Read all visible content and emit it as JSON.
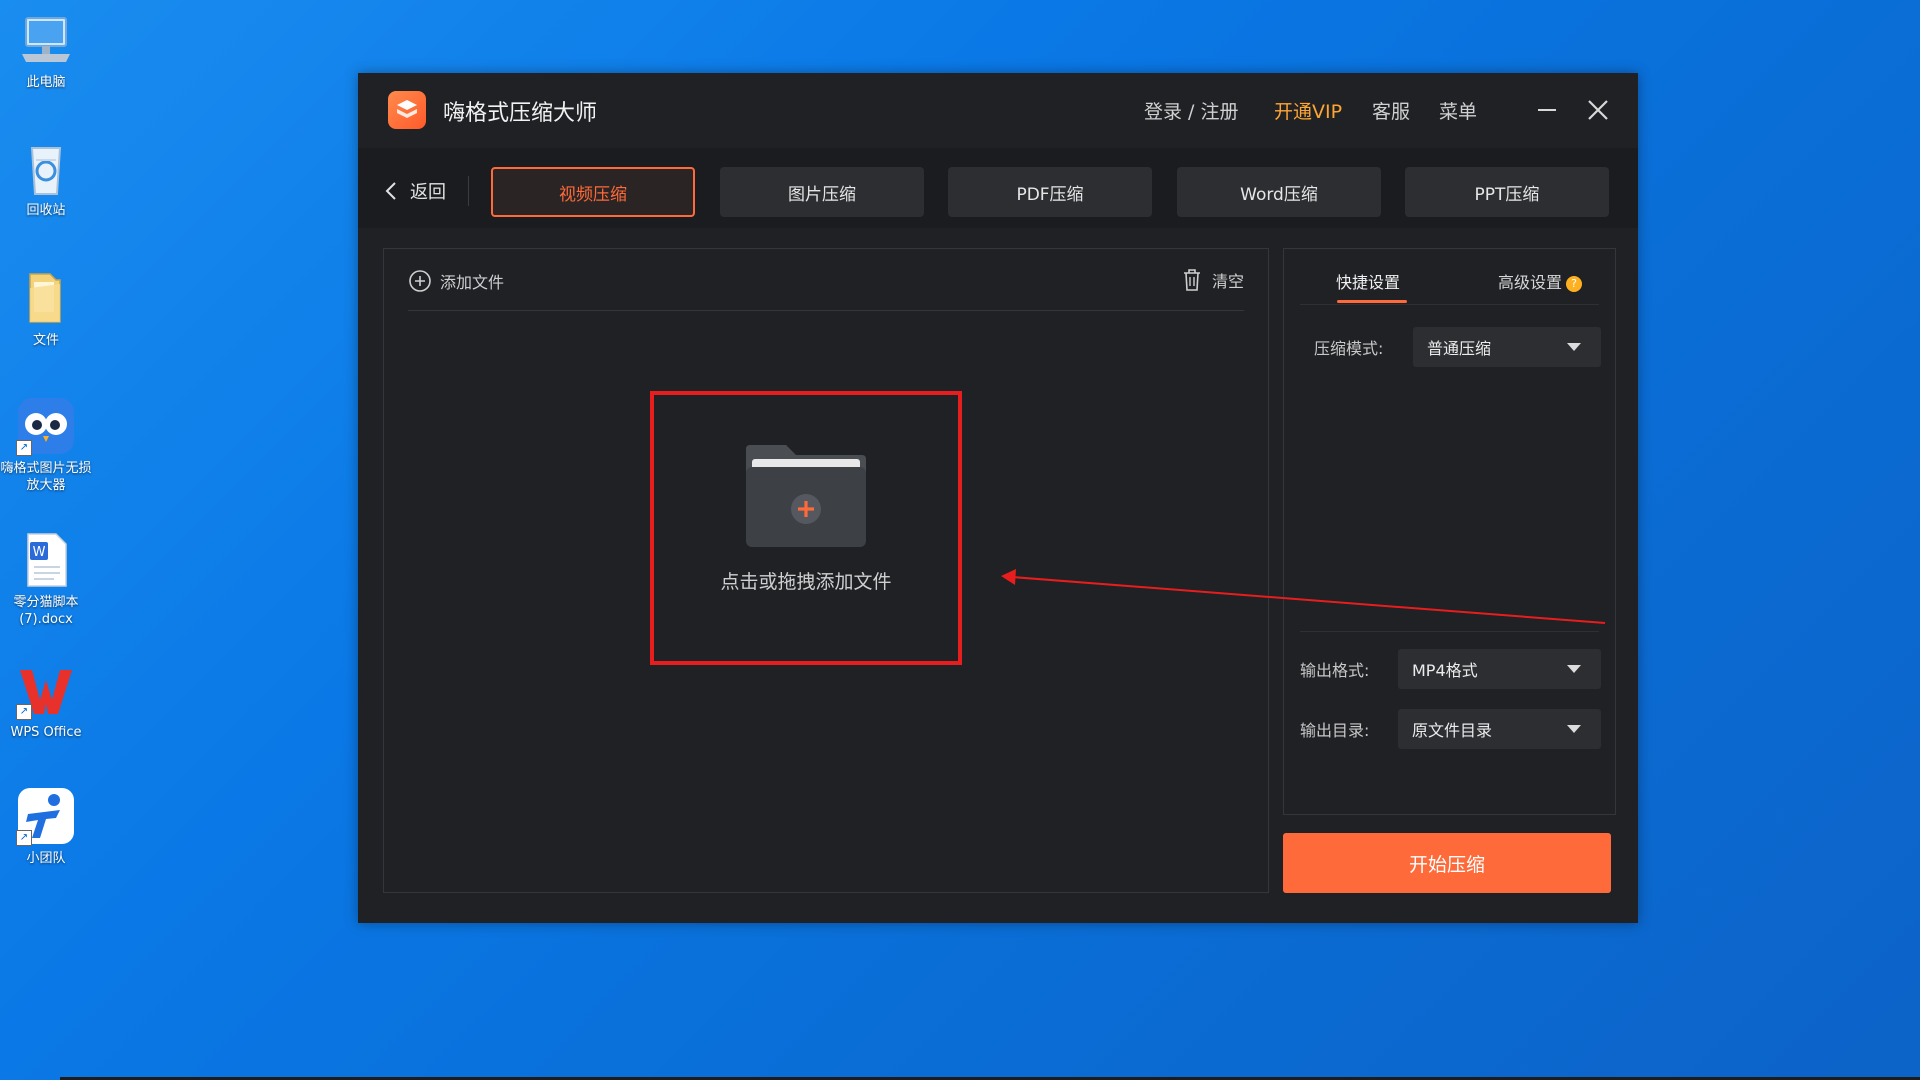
{
  "desktop": {
    "icons": [
      {
        "label": "此电脑",
        "icon": "computer-icon"
      },
      {
        "label": "回收站",
        "icon": "recycle-bin-icon"
      },
      {
        "label": "文件",
        "icon": "folder-icon"
      },
      {
        "label": "嗨格式图片无损放大器",
        "icon": "owl-app-icon"
      },
      {
        "label": "零分猫脚本(7).docx",
        "icon": "word-doc-icon"
      },
      {
        "label": "WPS Office",
        "icon": "wps-icon"
      },
      {
        "label": "小团队",
        "icon": "team-app-icon"
      }
    ]
  },
  "app": {
    "title": "嗨格式压缩大师",
    "header_links": {
      "login": "登录 / 注册",
      "vip": "开通VIP",
      "service": "客服",
      "menu": "菜单"
    },
    "back_label": "返回",
    "tabs": [
      {
        "label": "视频压缩",
        "active": true
      },
      {
        "label": "图片压缩",
        "active": false
      },
      {
        "label": "PDF压缩",
        "active": false
      },
      {
        "label": "Word压缩",
        "active": false
      },
      {
        "label": "PPT压缩",
        "active": false
      }
    ],
    "files_panel": {
      "add_file_label": "添加文件",
      "clear_label": "清空",
      "drop_text": "点击或拖拽添加文件"
    },
    "settings": {
      "tab_quick": "快捷设置",
      "tab_advanced": "高级设置",
      "compress_mode_label": "压缩模式:",
      "compress_mode_value": "普通压缩",
      "output_format_label": "输出格式:",
      "output_format_value": "MP4格式",
      "output_dir_label": "输出目录:",
      "output_dir_value": "原文件目录"
    },
    "start_button": "开始压缩"
  },
  "colors": {
    "accent": "#ff6a3a",
    "vip": "#ffa534",
    "highlight_box": "#e81d1d",
    "window_bg": "#1f2124"
  }
}
